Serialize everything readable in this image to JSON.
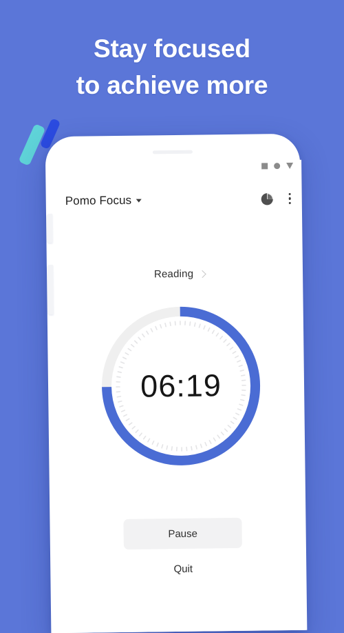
{
  "promo": {
    "headline_line1": "Stay focused",
    "headline_line2": "to achieve more",
    "background_color": "#5b76d8",
    "accent_color": "#4a6cd4",
    "deco_teal_color": "#5fd3d8",
    "deco_blue_color": "#2b4be0"
  },
  "phone": {
    "statusbar": {
      "icons": [
        "square-icon",
        "circle-icon",
        "triangle-down-icon"
      ],
      "icon_color": "#8b8b8b"
    },
    "appbar": {
      "title": "Pomo Focus",
      "dropdown_icon": "caret-down-icon",
      "chart_icon": "pie-chart-icon",
      "overflow_icon": "more-vertical-icon"
    },
    "task": {
      "label": "Reading",
      "chevron_icon": "chevron-right-icon"
    },
    "timer": {
      "time": "06:19",
      "progress_percent": 75,
      "track_color": "#efefef",
      "progress_color": "#4a6cd4",
      "tick_color": "#e4e4e6"
    },
    "actions": {
      "pause_label": "Pause",
      "quit_label": "Quit"
    }
  }
}
